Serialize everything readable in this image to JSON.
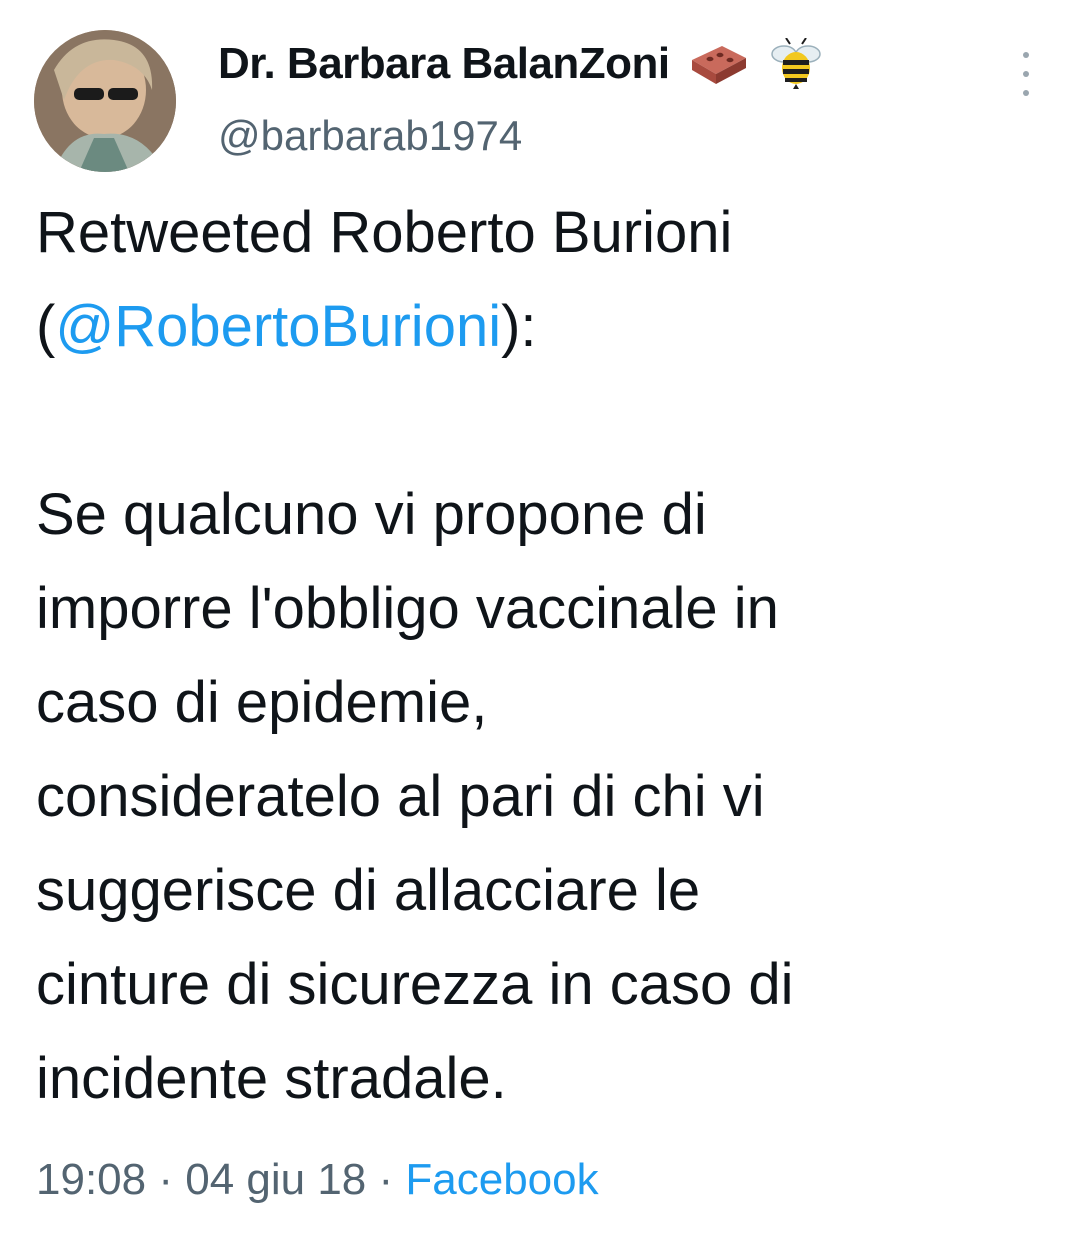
{
  "author": {
    "display_name": "Dr. Barbara BalanZoni",
    "handle": "@barbarab1974",
    "name_emojis": [
      "brick-emoji",
      "bee-emoji"
    ]
  },
  "tweet": {
    "retweet_prefix": "Retweeted Roberto Burioni",
    "open_paren": "(",
    "mention": "@RobertoBurioni",
    "close_paren": "):",
    "lines": [
      "Se qualcuno vi propone di",
      "imporre l'obbligo vaccinale in",
      "caso di epidemie,",
      "consideratelo al pari di chi vi",
      "suggerisce di allacciare le",
      "cinture di sicurezza in caso di",
      "incidente stradale."
    ]
  },
  "meta": {
    "time": "19:08",
    "separator": " · ",
    "date": "04 giu 18",
    "source": "Facebook"
  },
  "colors": {
    "link": "#1d9bf0",
    "secondary_text": "#536471",
    "primary_text": "#0f1419"
  }
}
